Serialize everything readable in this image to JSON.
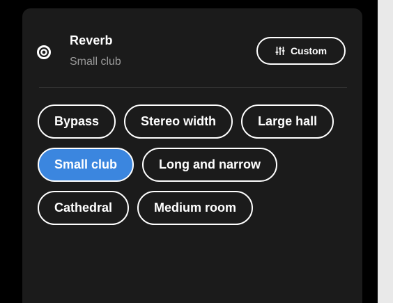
{
  "header": {
    "icon": "reverb-icon",
    "title": "Reverb",
    "subtitle": "Small club",
    "custom_button": {
      "icon": "equalizer-sliders-icon",
      "label": "Custom"
    }
  },
  "presets": [
    {
      "label": "Bypass",
      "selected": false
    },
    {
      "label": "Stereo width",
      "selected": false
    },
    {
      "label": "Large hall",
      "selected": false
    },
    {
      "label": "Small club",
      "selected": true
    },
    {
      "label": "Long and narrow",
      "selected": false
    },
    {
      "label": "Cathedral",
      "selected": false
    },
    {
      "label": "Medium room",
      "selected": false
    }
  ],
  "colors": {
    "panel_background": "#1b1b1b",
    "selected_chip": "#3b86df",
    "chip_border": "#ffffff",
    "subtitle_text": "#9b9b9b"
  }
}
